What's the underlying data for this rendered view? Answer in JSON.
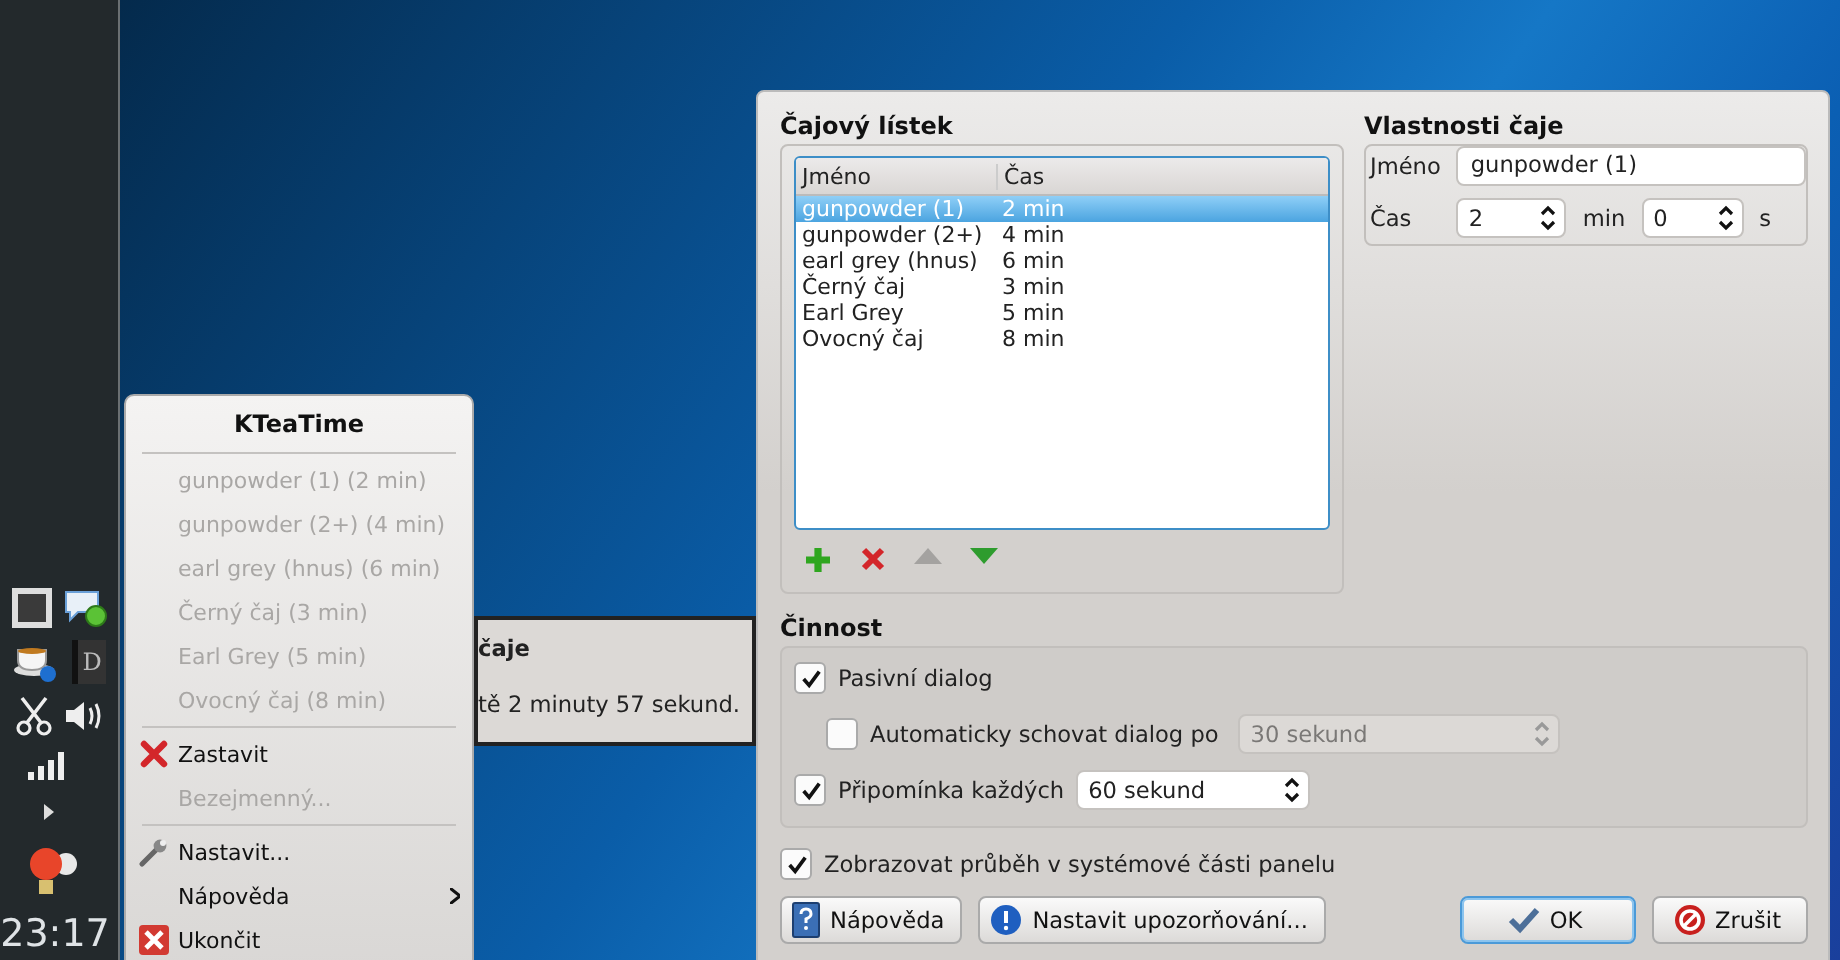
{
  "panel": {
    "book_letter": "D",
    "clock": "23:17"
  },
  "notification": {
    "title": "čaje",
    "text": "tě 2 minuty 57 sekund."
  },
  "menu": {
    "title": "KTeaTime",
    "items": [
      {
        "kind": "item",
        "label": "gunpowder (1) (2 min)",
        "disabled": true
      },
      {
        "kind": "item",
        "label": "gunpowder (2+) (4 min)",
        "disabled": true
      },
      {
        "kind": "item",
        "label": "earl grey (hnus) (6 min)",
        "disabled": true
      },
      {
        "kind": "item",
        "label": "Černý čaj (3 min)",
        "disabled": true
      },
      {
        "kind": "item",
        "label": "Earl Grey (5 min)",
        "disabled": true
      },
      {
        "kind": "item",
        "label": "Ovocný čaj (8 min)",
        "disabled": true
      },
      {
        "kind": "separator"
      },
      {
        "kind": "stop",
        "label": "Zastavit",
        "disabled": false
      },
      {
        "kind": "item",
        "label": "Bezejmenný...",
        "disabled": true
      },
      {
        "kind": "separator"
      },
      {
        "kind": "settings",
        "label": "Nastavit...",
        "disabled": false
      },
      {
        "kind": "submenu",
        "label": "Nápověda",
        "disabled": false
      },
      {
        "kind": "quit",
        "label": "Ukončit",
        "disabled": false
      }
    ]
  },
  "dialog": {
    "tea_list": {
      "title": "Čajový lístek",
      "columns": [
        "Jméno",
        "Čas"
      ],
      "rows": [
        {
          "name": "gunpowder (1)",
          "time": "2 min",
          "selected": true
        },
        {
          "name": "gunpowder (2+)",
          "time": "4 min",
          "selected": false
        },
        {
          "name": "earl grey (hnus)",
          "time": "6 min",
          "selected": false
        },
        {
          "name": "Černý čaj",
          "time": "3 min",
          "selected": false
        },
        {
          "name": "Earl Grey",
          "time": "5 min",
          "selected": false
        },
        {
          "name": "Ovocný čaj",
          "time": "8 min",
          "selected": false
        }
      ],
      "tools": [
        {
          "kind": "add",
          "disabled": false
        },
        {
          "kind": "remove",
          "disabled": false
        },
        {
          "kind": "up",
          "disabled": true
        },
        {
          "kind": "down",
          "disabled": false
        }
      ]
    },
    "properties": {
      "title": "Vlastnosti čaje",
      "name_label": "Jméno",
      "name_value": "gunpowder (1)",
      "time_label": "Čas",
      "minutes": "2",
      "minutes_unit": "min",
      "seconds": "0",
      "seconds_unit": "s"
    },
    "activity": {
      "title": "Činnost",
      "passive": {
        "label": "Pasivní dialog",
        "checked": true
      },
      "auto_hide": {
        "label": "Automaticky schovat dialog po",
        "checked": false,
        "value": "30 sekund",
        "disabled": true
      },
      "reminder": {
        "label": "Připomínka každých",
        "checked": true,
        "value": "60 sekund"
      }
    },
    "show_progress": {
      "label": "Zobrazovat průběh v systémové části panelu",
      "checked": true
    },
    "buttons": [
      {
        "kind": "help",
        "label": "Nápověda",
        "default": false
      },
      {
        "kind": "notify",
        "label": "Nastavit upozorňování...",
        "default": false
      },
      {
        "kind": "ok",
        "label": "OK",
        "default": true
      },
      {
        "kind": "cancel",
        "label": "Zrušit",
        "default": false
      }
    ]
  }
}
